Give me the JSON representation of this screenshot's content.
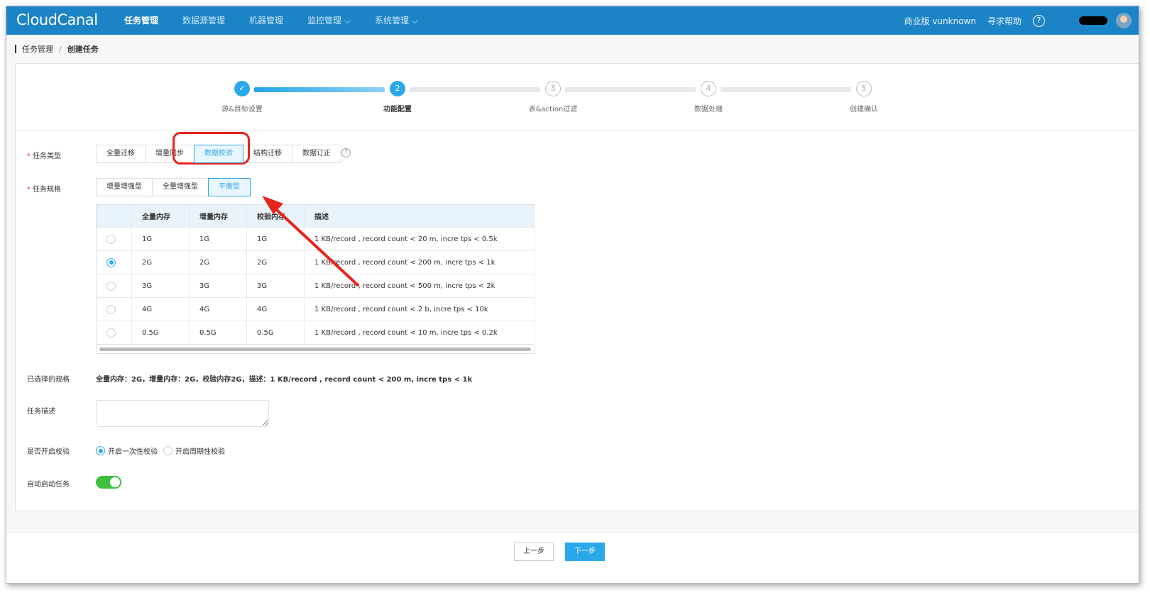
{
  "app": {
    "logo": "CloudCanal"
  },
  "nav": {
    "items": [
      {
        "label": "任务管理",
        "active": true
      },
      {
        "label": "数据源管理",
        "active": false
      },
      {
        "label": "机器管理",
        "active": false
      },
      {
        "label": "监控管理 ⌵",
        "active": false
      },
      {
        "label": "系统管理 ⌵",
        "active": false
      }
    ],
    "edition": "商业版 vunknown",
    "help": "寻求帮助",
    "help_icon": "?"
  },
  "breadcrumb": {
    "parent": "任务管理",
    "separator": "/",
    "current": "创建任务"
  },
  "steps": [
    {
      "label": "源&目标设置",
      "state": "done",
      "mark": "✓"
    },
    {
      "label": "功能配置",
      "state": "current",
      "mark": "2"
    },
    {
      "label": "表&action过滤",
      "state": "todo",
      "mark": "3"
    },
    {
      "label": "数据处理",
      "state": "todo",
      "mark": "4"
    },
    {
      "label": "创建确认",
      "state": "todo",
      "mark": "5"
    }
  ],
  "task_type": {
    "label": "任务类型",
    "required_mark": "*",
    "options": [
      "全量迁移",
      "增量同步",
      "数据校验",
      "结构迁移",
      "数据订正"
    ],
    "selected": "数据校验",
    "help_icon": "?"
  },
  "task_spec": {
    "label": "任务规格",
    "required_mark": "*",
    "options": [
      "增量增强型",
      "全量增强型",
      "平衡型"
    ],
    "selected": "平衡型",
    "table": {
      "headers": [
        "",
        "全量内存",
        "增量内存",
        "校验内存",
        "描述"
      ],
      "rows": [
        {
          "full": "1G",
          "incr": "1G",
          "check": "1G",
          "desc": "1 KB/record , record count < 20 m, incre tps < 0.5k",
          "selected": false
        },
        {
          "full": "2G",
          "incr": "2G",
          "check": "2G",
          "desc": "1 KB/record , record count < 200 m, incre tps < 1k",
          "selected": true
        },
        {
          "full": "3G",
          "incr": "3G",
          "check": "3G",
          "desc": "1 KB/record , record count < 500 m, incre tps < 2k",
          "selected": false
        },
        {
          "full": "4G",
          "incr": "4G",
          "check": "4G",
          "desc": "1 KB/record , record count < 2 b, incre tps < 10k",
          "selected": false
        },
        {
          "full": "0.5G",
          "incr": "0.5G",
          "check": "0.5G",
          "desc": "1 KB/record , record count < 10 m, incre tps < 0.2k",
          "selected": false
        }
      ]
    }
  },
  "selected_spec": {
    "label": "已选择的规格",
    "value": "全量内存：2G，增量内存：2G，校验内存2G，描述：1 KB/record , record count < 200 m, incre tps < 1k"
  },
  "task_desc": {
    "label": "任务描述",
    "value": ""
  },
  "verify": {
    "label": "是否开启校验",
    "options": [
      {
        "label": "开启一次性校验",
        "selected": true
      },
      {
        "label": "开启周期性校验",
        "selected": false
      }
    ]
  },
  "auto_start": {
    "label": "自动启动任务",
    "enabled": true
  },
  "footer": {
    "prev": "上一步",
    "next": "下一步"
  },
  "colors": {
    "topbar": "#1b84c6",
    "accent": "#2ba8ea",
    "toggle_on": "#3fbf3f",
    "annotation": "#e8231c"
  }
}
